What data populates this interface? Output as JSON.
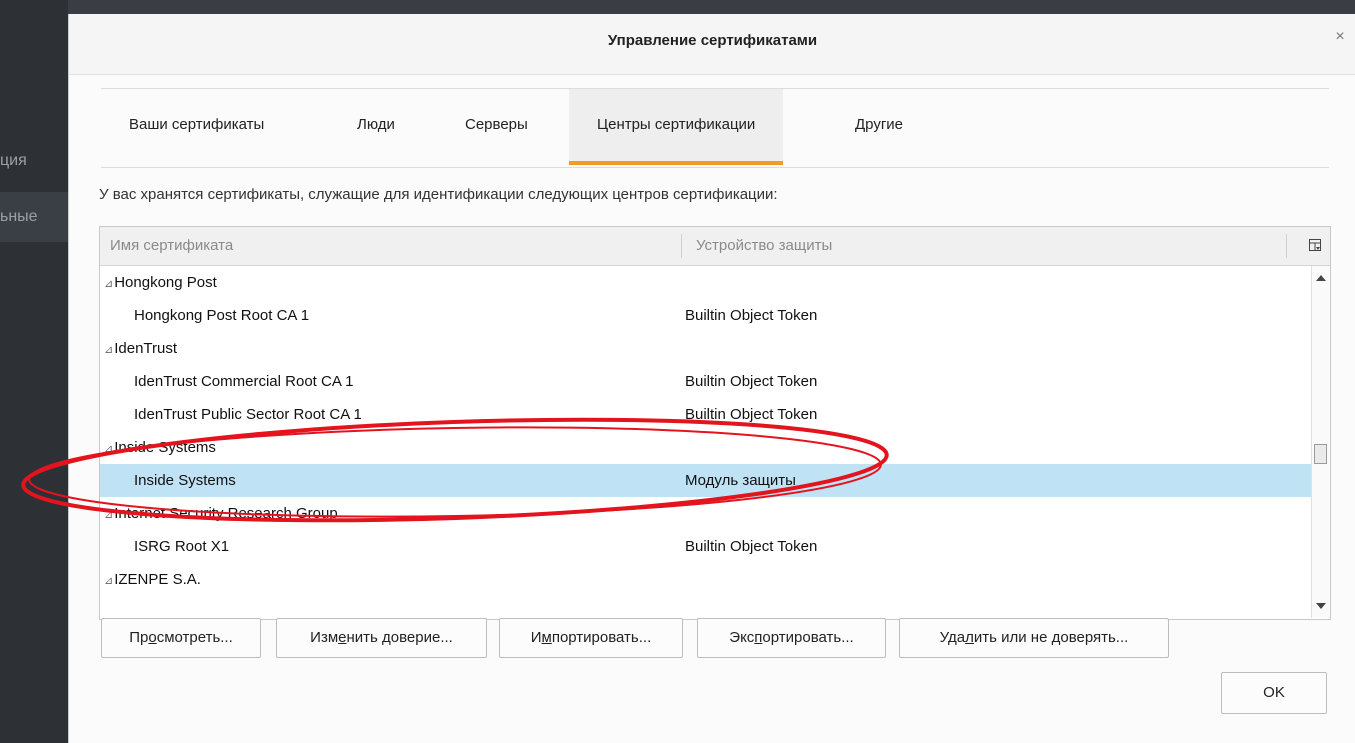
{
  "background": {
    "partial_text_1": "ция",
    "partial_text_2": "ьные"
  },
  "dialog": {
    "title": "Управление сертификатами",
    "close_icon": "close-icon"
  },
  "tabs": [
    {
      "label": "Ваши сертификаты"
    },
    {
      "label": "Люди"
    },
    {
      "label": "Серверы"
    },
    {
      "label": "Центры сертификации",
      "active": true
    },
    {
      "label": "Другие"
    }
  ],
  "description": "У вас хранятся сертификаты, служащие для идентификации следующих центров сертификации:",
  "table": {
    "col_name": "Имя сертификата",
    "col_device": "Устройство защиты",
    "rows": [
      {
        "type": "group",
        "twisty": "⊿",
        "name": "Hongkong Post",
        "device": ""
      },
      {
        "type": "item",
        "name": "Hongkong Post Root CA 1",
        "device": "Builtin Object Token"
      },
      {
        "type": "group",
        "twisty": "⊿",
        "name": "IdenTrust",
        "device": ""
      },
      {
        "type": "item",
        "name": "IdenTrust Commercial Root CA 1",
        "device": "Builtin Object Token"
      },
      {
        "type": "item",
        "name": "IdenTrust Public Sector Root CA 1",
        "device": "Builtin Object Token"
      },
      {
        "type": "group",
        "twisty": "⊿",
        "name": "Inside Systems",
        "device": ""
      },
      {
        "type": "item",
        "name": "Inside Systems",
        "device": "Модуль защиты",
        "selected": true
      },
      {
        "type": "group",
        "twisty": "⊿",
        "name": "Internet Security Research Group",
        "device": ""
      },
      {
        "type": "item",
        "name": "ISRG Root X1",
        "device": "Builtin Object Token"
      },
      {
        "type": "group",
        "twisty": "⊿",
        "name": "IZENPE S.A.",
        "device": ""
      }
    ]
  },
  "buttons": {
    "view": {
      "pre": "Пр",
      "u": "о",
      "post": "смотреть..."
    },
    "edit": {
      "pre": "Изм",
      "u": "е",
      "post": "нить доверие..."
    },
    "import": {
      "pre": "И",
      "u": "м",
      "post": "портировать..."
    },
    "export": {
      "pre": "Экс",
      "u": "п",
      "post": "ортировать..."
    },
    "delete": {
      "pre": "Уда",
      "u": "л",
      "post": "ить или не доверять..."
    },
    "ok": "OK"
  },
  "colors": {
    "tab_accent": "#f29a26",
    "selected_row": "#bfe3f5",
    "annotation_ellipse": "#e3141d"
  }
}
